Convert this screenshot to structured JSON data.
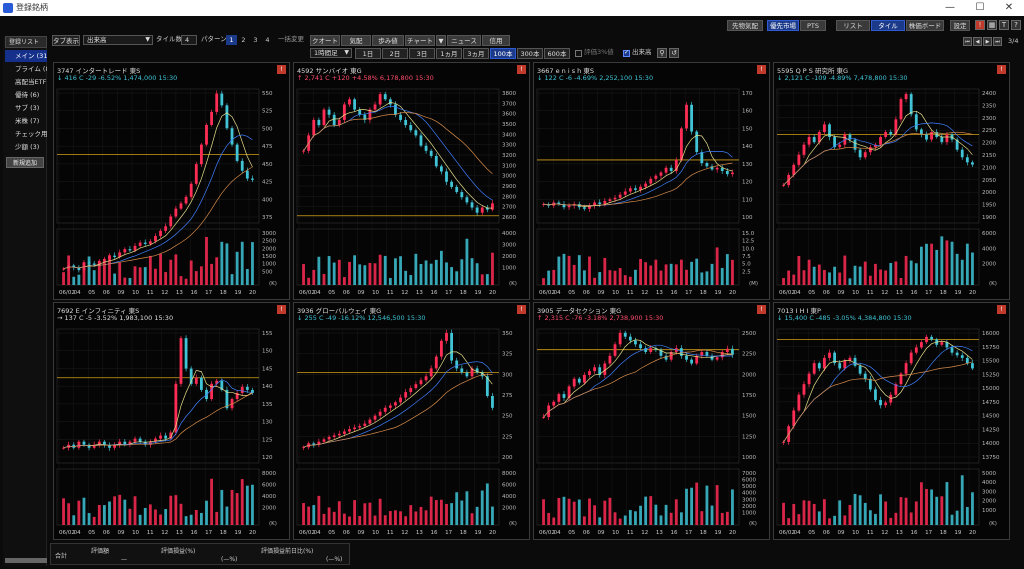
{
  "window": {
    "title": "登録銘柄",
    "min": "—",
    "max": "☐",
    "close": "✕"
  },
  "topbar": {
    "buttons": [
      {
        "label": "先物気配",
        "active": false
      },
      {
        "label": "優先市場",
        "active": true
      },
      {
        "label": "PTS",
        "active": false
      },
      {
        "label": "リスト",
        "active": false
      },
      {
        "label": "タイル",
        "active": true
      },
      {
        "label": "株価ボード",
        "active": false
      },
      {
        "label": "設定",
        "active": false
      }
    ]
  },
  "sidebar": {
    "header": "登録リスト",
    "items": [
      {
        "label": "メイン (31)",
        "active": true
      },
      {
        "label": "プライム (8)",
        "active": false
      },
      {
        "label": "高配当ETF",
        "active": false
      },
      {
        "label": "優待 (6)",
        "active": false
      },
      {
        "label": "サブ (3)",
        "active": false
      },
      {
        "label": "米株 (7)",
        "active": false
      },
      {
        "label": "チェック用 (",
        "active": false
      },
      {
        "label": "少額 (3)",
        "active": false
      }
    ],
    "add_label": "新規追加"
  },
  "toolbar": {
    "tab_display": "タブ表示",
    "market_select": "出来高",
    "tile_count_label": "タイル数",
    "tile_count": "4",
    "pattern_label": "パターン",
    "patterns": [
      "1",
      "2",
      "3",
      "4"
    ],
    "pattern_active": "1",
    "bulk_change": "一括変更",
    "actions": [
      "クオート",
      "気配",
      "歩み値",
      "チャート",
      "ニュース",
      "信用"
    ],
    "interval_select": "1時間足",
    "ranges": [
      "1日",
      "2日",
      "3日",
      "1ヵ月",
      "3ヵ月",
      "100本",
      "300本",
      "600本"
    ],
    "range_active": "100本",
    "valuation_3pct": "評価3%値",
    "volume_label": "出来高",
    "page": "3/4"
  },
  "footer": {
    "total_label": "合計",
    "valuation_label": "評価額",
    "valuation_value": "—",
    "pl_label": "評価損益(%)",
    "pl_value": "(—%)",
    "pl_prev_label": "評価損益前日比(%)",
    "pl_prev_value": "(—%)"
  },
  "colors": {
    "up": "#ff2d55",
    "down": "#40c4d6",
    "accent": "#1b3a8a"
  },
  "panels": [
    {
      "header": "3747  インタートレード   東S",
      "quote": "↓  416 C   -29  -6.52%   1,474,000   15:30",
      "dir": "down",
      "chart_data": {
        "type": "candlestick",
        "ylim": [
          350,
          555
        ],
        "yticks": [
          "550",
          "525",
          "500",
          "475",
          "450",
          "425",
          "400",
          "375"
        ],
        "vticks": [
          "3000",
          "2500",
          "2000",
          "1500",
          "1000",
          "500"
        ],
        "vunit": "(K)",
        "xticks": [
          "06/02",
          "04",
          "05",
          "06",
          "09",
          "10",
          "11",
          "12",
          "13",
          "16",
          "17",
          "18",
          "19",
          "20"
        ],
        "hline": 455,
        "series": [
          280,
          285,
          282,
          278,
          290,
          288,
          286,
          292,
          295,
          300,
          298,
          305,
          310,
          308,
          315,
          320,
          318,
          322,
          330,
          338,
          345,
          360,
          372,
          380,
          390,
          410,
          440,
          470,
          500,
          520,
          548,
          530,
          495,
          470,
          445,
          430,
          418,
          416
        ]
      }
    },
    {
      "header": "4592  サンバイオ   東G",
      "quote": "↑  2,741 C   +120  +4.58%   6,178,800   15:30",
      "dir": "up",
      "chart_data": {
        "type": "candlestick",
        "ylim": [
          2550,
          3850
        ],
        "yticks": [
          "3800",
          "3700",
          "3600",
          "3500",
          "3400",
          "3300",
          "3200",
          "3100",
          "3000",
          "2900",
          "2800",
          "2700",
          "2600"
        ],
        "vticks": [
          "4000",
          "3000",
          "2000",
          "1000"
        ],
        "vunit": "(K)",
        "xticks": [
          "06/02",
          "04",
          "05",
          "06",
          "09",
          "10",
          "11",
          "12",
          "13",
          "16",
          "17",
          "18",
          "19",
          "20"
        ],
        "hline": 2620,
        "series": [
          3250,
          3400,
          3550,
          3500,
          3650,
          3600,
          3500,
          3550,
          3700,
          3750,
          3650,
          3600,
          3550,
          3650,
          3700,
          3800,
          3750,
          3700,
          3600,
          3550,
          3500,
          3450,
          3400,
          3300,
          3250,
          3200,
          3100,
          3050,
          2950,
          2900,
          2850,
          2800,
          2750,
          2700,
          2650,
          2700,
          2680,
          2741
        ]
      }
    },
    {
      "header": "3667  e n i s h   東S",
      "quote": "↓  122 C   -6  -4.69%   2,252,100   15:30",
      "dir": "down",
      "chart_data": {
        "type": "candlestick",
        "ylim": [
          90,
          175
        ],
        "yticks": [
          "170",
          "160",
          "150",
          "140",
          "130",
          "120",
          "110",
          "100"
        ],
        "vticks": [
          "15.0",
          "12.5",
          "10.0",
          "7.5",
          "5.0",
          "2.5"
        ],
        "vunit": "(M)",
        "xticks": [
          "06/02",
          "04",
          "05",
          "06",
          "09",
          "10",
          "11",
          "12",
          "13",
          "16",
          "17",
          "18",
          "19",
          "20"
        ],
        "hline": 130,
        "series": [
          102,
          101,
          103,
          102,
          100,
          101,
          102,
          100,
          99,
          101,
          103,
          102,
          104,
          105,
          106,
          108,
          110,
          112,
          111,
          113,
          115,
          118,
          120,
          122,
          125,
          123,
          130,
          150,
          165,
          148,
          135,
          128,
          126,
          124,
          125,
          123,
          121,
          122
        ]
      }
    },
    {
      "header": "5595  Q P S 研究所   東G",
      "quote": "↓  2,121 C   -109  -4.89%   7,478,800   15:30",
      "dir": "down",
      "chart_data": {
        "type": "candlestick",
        "ylim": [
          1890,
          2420
        ],
        "yticks": [
          "2400",
          "2350",
          "2300",
          "2250",
          "2200",
          "2150",
          "2100",
          "2050",
          "2000",
          "1950",
          "1900"
        ],
        "vticks": [
          "6000",
          "4000",
          "2000"
        ],
        "vunit": "(K)",
        "xticks": [
          "06/02",
          "04",
          "05",
          "06",
          "09",
          "10",
          "11",
          "12",
          "13",
          "16",
          "17",
          "18",
          "19",
          "20"
        ],
        "hline": 2240,
        "series": [
          2040,
          2080,
          2120,
          2160,
          2200,
          2230,
          2210,
          2250,
          2280,
          2230,
          2190,
          2200,
          2240,
          2220,
          2180,
          2150,
          2170,
          2190,
          2200,
          2230,
          2250,
          2240,
          2300,
          2380,
          2400,
          2320,
          2260,
          2240,
          2220,
          2250,
          2230,
          2210,
          2240,
          2220,
          2180,
          2150,
          2130,
          2121
        ]
      }
    },
    {
      "header": "7692  E インフィニティ   東S",
      "quote": "→  137 C   -5  -3.52%   1,983,100   15:30",
      "dir": "neu",
      "chart_data": {
        "type": "candlestick",
        "ylim": [
          114,
          158
        ],
        "yticks": [
          "155",
          "150",
          "145",
          "140",
          "135",
          "130",
          "125",
          "120"
        ],
        "vticks": [
          "8000",
          "6000",
          "4000",
          "2000"
        ],
        "vunit": "(K)",
        "xticks": [
          "06/02",
          "04",
          "05",
          "06",
          "09",
          "10",
          "11",
          "12",
          "13",
          "16",
          "17",
          "18",
          "19",
          "20"
        ],
        "hline": 142,
        "series": [
          119,
          120,
          119,
          121,
          120,
          119,
          120,
          121,
          120,
          119,
          120,
          121,
          120,
          121,
          122,
          121,
          120,
          121,
          122,
          123,
          122,
          124,
          140,
          155,
          145,
          140,
          142,
          138,
          135,
          140,
          141,
          138,
          132,
          135,
          137,
          139,
          138,
          137
        ]
      }
    },
    {
      "header": "3936  グローバルウェイ   東G",
      "quote": "↓  255 C   -49  -16.12%   12,546,500   15:30",
      "dir": "down",
      "chart_data": {
        "type": "candlestick",
        "ylim": [
          185,
          355
        ],
        "yticks": [
          "350",
          "325",
          "300",
          "275",
          "250",
          "225",
          "200"
        ],
        "vticks": [
          "8000",
          "6000",
          "4000",
          "2000"
        ],
        "vunit": "(K)",
        "xticks": [
          "06/02",
          "04",
          "05",
          "06",
          "09",
          "10",
          "11",
          "12",
          "13",
          "16",
          "17",
          "18",
          "19",
          "20"
        ],
        "hline": 300,
        "series": [
          205,
          210,
          208,
          212,
          215,
          218,
          220,
          222,
          225,
          228,
          230,
          232,
          235,
          240,
          245,
          250,
          255,
          258,
          262,
          268,
          275,
          280,
          285,
          290,
          295,
          305,
          320,
          340,
          350,
          315,
          305,
          300,
          295,
          305,
          300,
          295,
          270,
          255
        ]
      }
    },
    {
      "header": "3905  データセクション   東G",
      "quote": "↑  2,315 C   -76  -3.18%   2,738,900   15:30",
      "dir": "up",
      "chart_data": {
        "type": "candlestick",
        "ylim": [
          900,
          2650
        ],
        "yticks": [
          "2500",
          "2250",
          "2000",
          "1750",
          "1500",
          "1250",
          "1000"
        ],
        "vticks": [
          "7000",
          "6000",
          "5000",
          "4000",
          "3000",
          "2000",
          "1000"
        ],
        "vunit": "(K)",
        "xticks": [
          "06/02",
          "04",
          "05",
          "06",
          "09",
          "10",
          "11",
          "12",
          "13",
          "16",
          "17",
          "18",
          "19",
          "20"
        ],
        "hline": 2380,
        "series": [
          1500,
          1650,
          1700,
          1800,
          1750,
          1900,
          2000,
          1950,
          2050,
          2100,
          2150,
          2050,
          2200,
          2300,
          2450,
          2600,
          2550,
          2500,
          2450,
          2400,
          2350,
          2400,
          2380,
          2300,
          2250,
          2350,
          2400,
          2300,
          2250,
          2200,
          2300,
          2350,
          2300,
          2250,
          2280,
          2350,
          2391,
          2315
        ]
      }
    },
    {
      "header": "7013  I H I   東P",
      "quote": "↓  15,400 C   -485  -3.05%   4,384,800   15:30",
      "dir": "down",
      "chart_data": {
        "type": "candlestick",
        "ylim": [
          13600,
          16150
        ],
        "yticks": [
          "16000",
          "15750",
          "15500",
          "15250",
          "15000",
          "14750",
          "14500",
          "14250",
          "14000",
          "13750"
        ],
        "vticks": [
          "5000",
          "4000",
          "3000",
          "2000",
          "1000"
        ],
        "vunit": "(K)",
        "xticks": [
          "06/02",
          "04",
          "05",
          "06",
          "09",
          "10",
          "11",
          "12",
          "13",
          "16",
          "17",
          "18",
          "19",
          "20"
        ],
        "hline": 15950,
        "series": [
          14000,
          14300,
          14600,
          14900,
          15100,
          15300,
          15500,
          15400,
          15600,
          15700,
          15500,
          15400,
          15550,
          15600,
          15450,
          15300,
          15200,
          15000,
          14800,
          14700,
          14750,
          14900,
          15100,
          15300,
          15500,
          15700,
          15800,
          15900,
          16000,
          15950,
          15850,
          15900,
          15800,
          15700,
          15650,
          15600,
          15500,
          15400
        ]
      }
    }
  ]
}
